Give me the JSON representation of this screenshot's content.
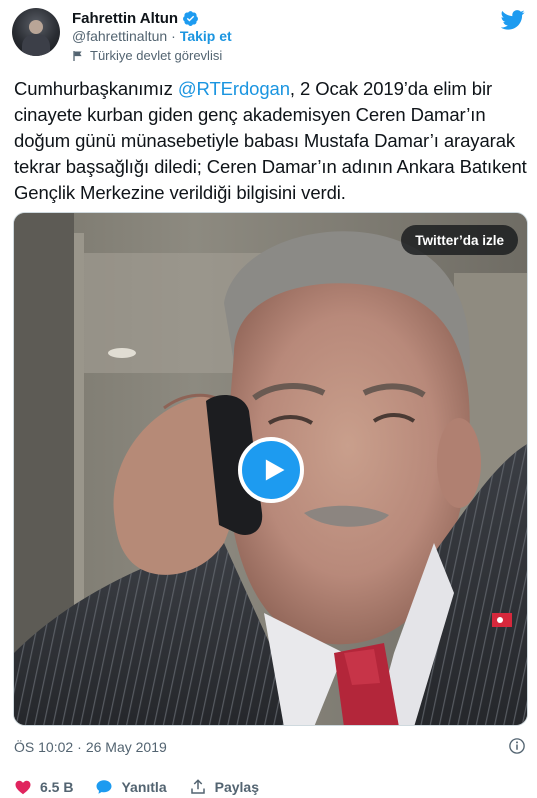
{
  "author": {
    "name": "Fahrettin Altun",
    "handle": "@fahrettinaltun",
    "separator": "·",
    "follow_label": "Takip et",
    "account_label": "Türkiye devlet görevlisi"
  },
  "tweet": {
    "text_before": "Cumhurbaşkanımız ",
    "mention": "@RTErdogan",
    "text_after": ", 2 Ocak 2019’da elim bir cinayete kurban giden genç akademisyen Ceren Damar’ın doğum günü münasebetiyle babası Mustafa Damar’ı arayarak tekrar başsağlığı diledi; Ceren Damar’ın adının Ankara Batıkent Gençlik Merkezine verildiği bilgisini verdi."
  },
  "media": {
    "watch_label": "Twitter’da izle"
  },
  "meta": {
    "time": "ÖS 10:02",
    "separator": "·",
    "date": "26 May 2019"
  },
  "actions": {
    "like_count": "6.5 B",
    "reply_label": "Yanıtla",
    "share_label": "Paylaş"
  },
  "colors": {
    "accent": "#1b95e0",
    "like": "#e0245e",
    "verified": "#1d9bf0"
  }
}
